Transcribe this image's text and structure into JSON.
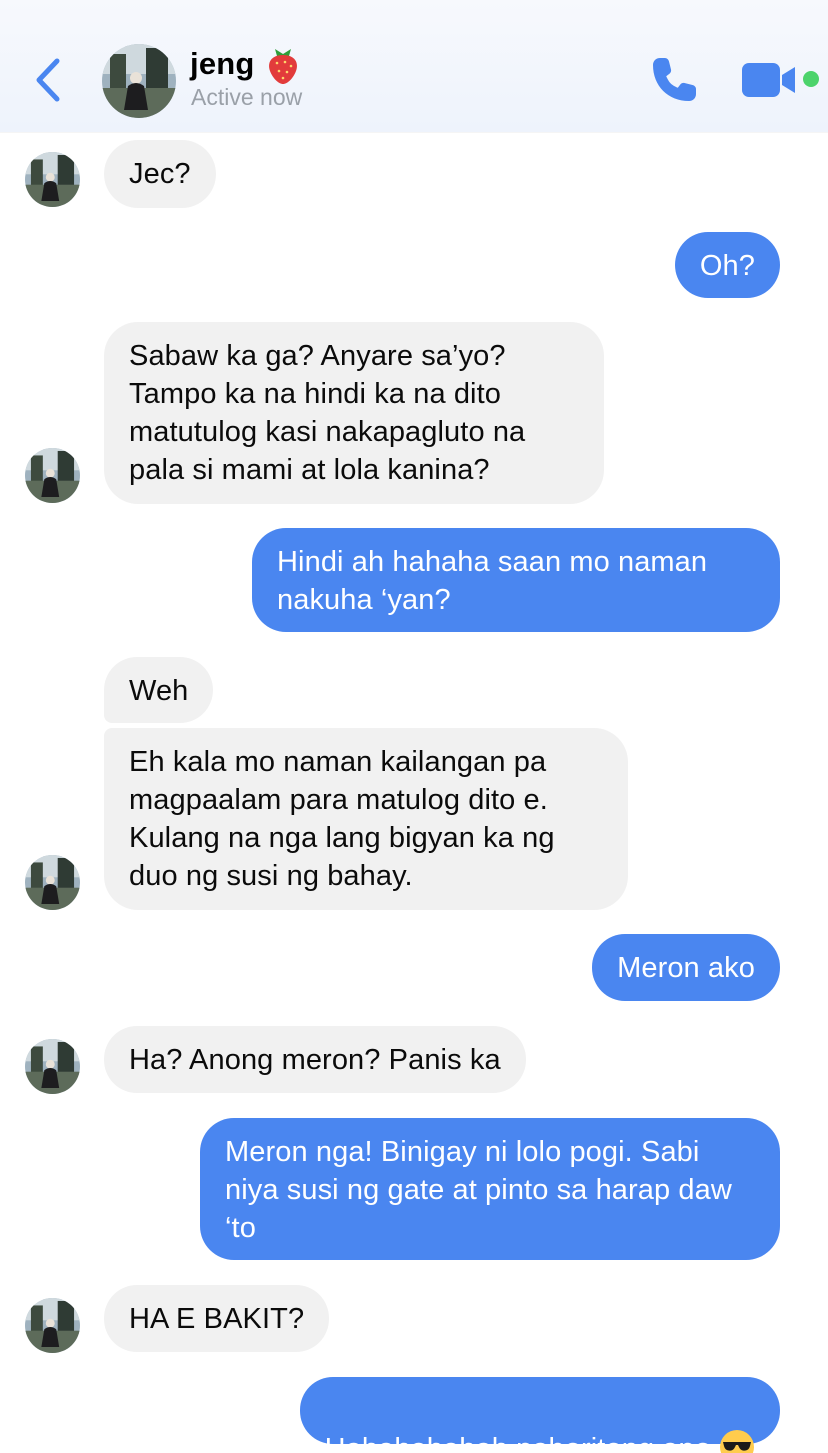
{
  "header": {
    "back_label": "Back",
    "contact_name": "jeng",
    "name_emoji": "strawberry",
    "status": "Active now",
    "call_icon": "phone-icon",
    "video_icon": "video-camera-icon"
  },
  "colors": {
    "accent": "#4a86f0",
    "incoming_bubble": "#f1f1f1",
    "online": "#4cd36b"
  },
  "messages": [
    {
      "from": "jeng",
      "text": "Jec?"
    },
    {
      "from": "me",
      "text": "Oh?"
    },
    {
      "from": "jeng",
      "text": "Sabaw ka ga? Anyare sa’yo? Tampo ka na hindi ka na dito matutulog kasi nakapagluto na pala si mami at lola kanina?"
    },
    {
      "from": "me",
      "text": "Hindi ah hahaha saan mo naman nakuha ‘yan?"
    },
    {
      "from": "jeng",
      "text": "Weh"
    },
    {
      "from": "jeng",
      "text": "Eh kala mo naman kailangan pa magpaalam para matulog dito e. Kulang na nga lang bigyan ka ng duo ng susi ng bahay."
    },
    {
      "from": "me",
      "text": "Meron ako"
    },
    {
      "from": "jeng",
      "text": "Ha? Anong meron? Panis ka"
    },
    {
      "from": "me",
      "text": "Meron nga! Binigay ni lolo pogi. Sabi niya susi ng gate at pinto sa harap daw ‘to"
    },
    {
      "from": "jeng",
      "text": "HA E BAKIT?"
    },
    {
      "from": "me",
      "text": "Hahahahahah paboritong apo",
      "emoji": "smiling-face-with-sunglasses"
    }
  ]
}
